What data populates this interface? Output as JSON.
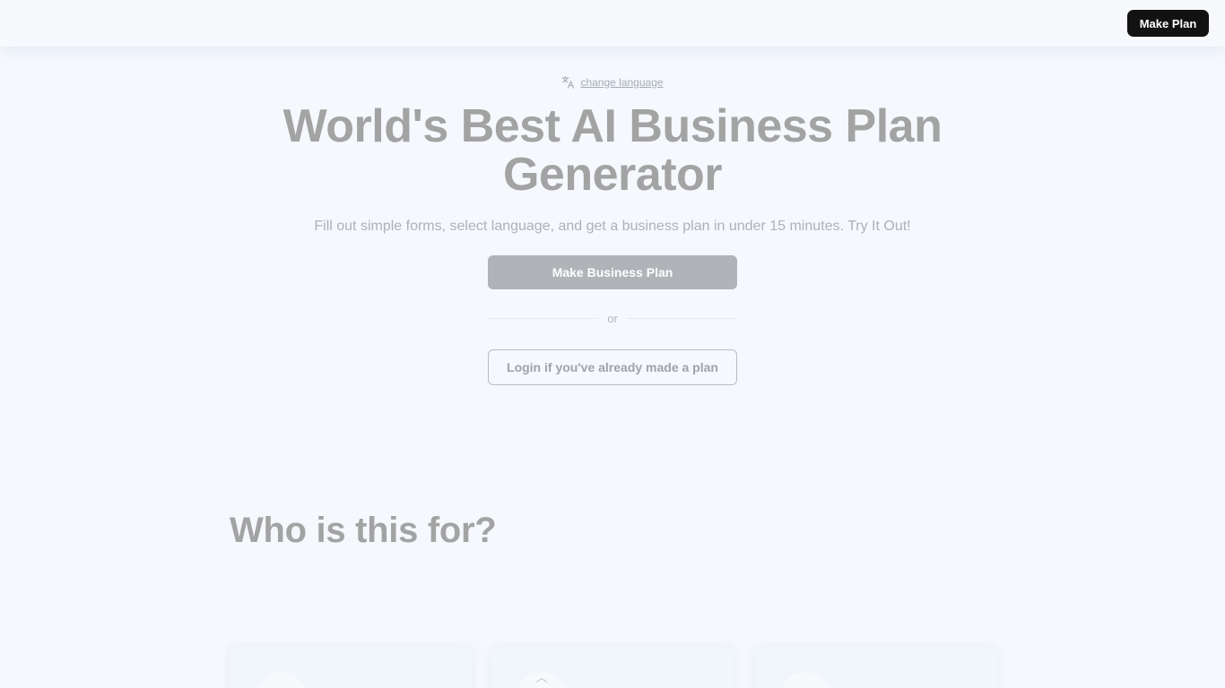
{
  "header": {
    "cta_label": "Make Plan"
  },
  "language": {
    "link_label": "change language"
  },
  "hero": {
    "title": "World's Best AI Business Plan Generator",
    "subtitle": "Fill out simple forms, select language, and get a business plan in under 15 minutes. Try It Out!",
    "primary_cta": "Make Business Plan",
    "divider_text": "or",
    "secondary_cta": "Login if you've already made a plan"
  },
  "audience": {
    "title": "Who is this for?"
  },
  "colors": {
    "cta_dark": "#121212",
    "primary_disabled": "#b0b3b8",
    "background": "#f5f8fd"
  }
}
